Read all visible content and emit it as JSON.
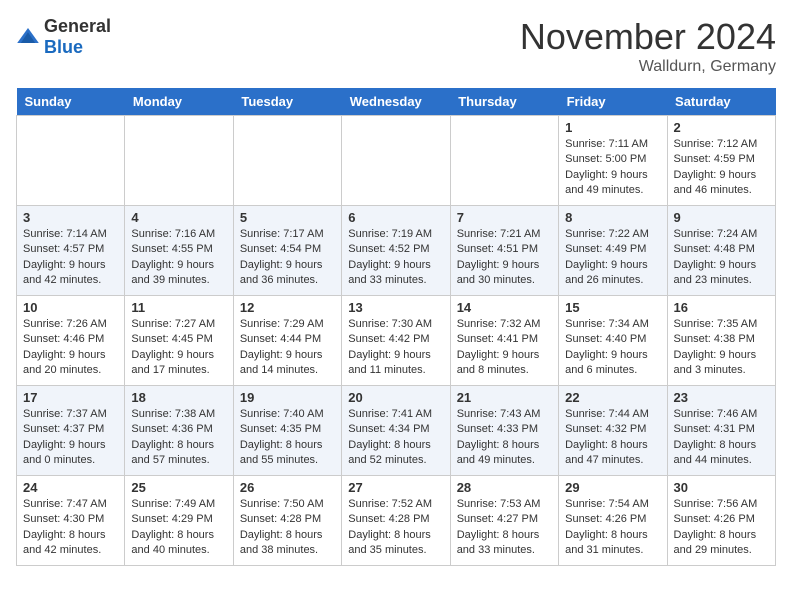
{
  "header": {
    "logo_general": "General",
    "logo_blue": "Blue",
    "month_title": "November 2024",
    "location": "Walldurn, Germany"
  },
  "days_of_week": [
    "Sunday",
    "Monday",
    "Tuesday",
    "Wednesday",
    "Thursday",
    "Friday",
    "Saturday"
  ],
  "weeks": [
    [
      {
        "day": "",
        "info": ""
      },
      {
        "day": "",
        "info": ""
      },
      {
        "day": "",
        "info": ""
      },
      {
        "day": "",
        "info": ""
      },
      {
        "day": "",
        "info": ""
      },
      {
        "day": "1",
        "info": "Sunrise: 7:11 AM\nSunset: 5:00 PM\nDaylight: 9 hours\nand 49 minutes."
      },
      {
        "day": "2",
        "info": "Sunrise: 7:12 AM\nSunset: 4:59 PM\nDaylight: 9 hours\nand 46 minutes."
      }
    ],
    [
      {
        "day": "3",
        "info": "Sunrise: 7:14 AM\nSunset: 4:57 PM\nDaylight: 9 hours\nand 42 minutes."
      },
      {
        "day": "4",
        "info": "Sunrise: 7:16 AM\nSunset: 4:55 PM\nDaylight: 9 hours\nand 39 minutes."
      },
      {
        "day": "5",
        "info": "Sunrise: 7:17 AM\nSunset: 4:54 PM\nDaylight: 9 hours\nand 36 minutes."
      },
      {
        "day": "6",
        "info": "Sunrise: 7:19 AM\nSunset: 4:52 PM\nDaylight: 9 hours\nand 33 minutes."
      },
      {
        "day": "7",
        "info": "Sunrise: 7:21 AM\nSunset: 4:51 PM\nDaylight: 9 hours\nand 30 minutes."
      },
      {
        "day": "8",
        "info": "Sunrise: 7:22 AM\nSunset: 4:49 PM\nDaylight: 9 hours\nand 26 minutes."
      },
      {
        "day": "9",
        "info": "Sunrise: 7:24 AM\nSunset: 4:48 PM\nDaylight: 9 hours\nand 23 minutes."
      }
    ],
    [
      {
        "day": "10",
        "info": "Sunrise: 7:26 AM\nSunset: 4:46 PM\nDaylight: 9 hours\nand 20 minutes."
      },
      {
        "day": "11",
        "info": "Sunrise: 7:27 AM\nSunset: 4:45 PM\nDaylight: 9 hours\nand 17 minutes."
      },
      {
        "day": "12",
        "info": "Sunrise: 7:29 AM\nSunset: 4:44 PM\nDaylight: 9 hours\nand 14 minutes."
      },
      {
        "day": "13",
        "info": "Sunrise: 7:30 AM\nSunset: 4:42 PM\nDaylight: 9 hours\nand 11 minutes."
      },
      {
        "day": "14",
        "info": "Sunrise: 7:32 AM\nSunset: 4:41 PM\nDaylight: 9 hours\nand 8 minutes."
      },
      {
        "day": "15",
        "info": "Sunrise: 7:34 AM\nSunset: 4:40 PM\nDaylight: 9 hours\nand 6 minutes."
      },
      {
        "day": "16",
        "info": "Sunrise: 7:35 AM\nSunset: 4:38 PM\nDaylight: 9 hours\nand 3 minutes."
      }
    ],
    [
      {
        "day": "17",
        "info": "Sunrise: 7:37 AM\nSunset: 4:37 PM\nDaylight: 9 hours\nand 0 minutes."
      },
      {
        "day": "18",
        "info": "Sunrise: 7:38 AM\nSunset: 4:36 PM\nDaylight: 8 hours\nand 57 minutes."
      },
      {
        "day": "19",
        "info": "Sunrise: 7:40 AM\nSunset: 4:35 PM\nDaylight: 8 hours\nand 55 minutes."
      },
      {
        "day": "20",
        "info": "Sunrise: 7:41 AM\nSunset: 4:34 PM\nDaylight: 8 hours\nand 52 minutes."
      },
      {
        "day": "21",
        "info": "Sunrise: 7:43 AM\nSunset: 4:33 PM\nDaylight: 8 hours\nand 49 minutes."
      },
      {
        "day": "22",
        "info": "Sunrise: 7:44 AM\nSunset: 4:32 PM\nDaylight: 8 hours\nand 47 minutes."
      },
      {
        "day": "23",
        "info": "Sunrise: 7:46 AM\nSunset: 4:31 PM\nDaylight: 8 hours\nand 44 minutes."
      }
    ],
    [
      {
        "day": "24",
        "info": "Sunrise: 7:47 AM\nSunset: 4:30 PM\nDaylight: 8 hours\nand 42 minutes."
      },
      {
        "day": "25",
        "info": "Sunrise: 7:49 AM\nSunset: 4:29 PM\nDaylight: 8 hours\nand 40 minutes."
      },
      {
        "day": "26",
        "info": "Sunrise: 7:50 AM\nSunset: 4:28 PM\nDaylight: 8 hours\nand 38 minutes."
      },
      {
        "day": "27",
        "info": "Sunrise: 7:52 AM\nSunset: 4:28 PM\nDaylight: 8 hours\nand 35 minutes."
      },
      {
        "day": "28",
        "info": "Sunrise: 7:53 AM\nSunset: 4:27 PM\nDaylight: 8 hours\nand 33 minutes."
      },
      {
        "day": "29",
        "info": "Sunrise: 7:54 AM\nSunset: 4:26 PM\nDaylight: 8 hours\nand 31 minutes."
      },
      {
        "day": "30",
        "info": "Sunrise: 7:56 AM\nSunset: 4:26 PM\nDaylight: 8 hours\nand 29 minutes."
      }
    ]
  ]
}
